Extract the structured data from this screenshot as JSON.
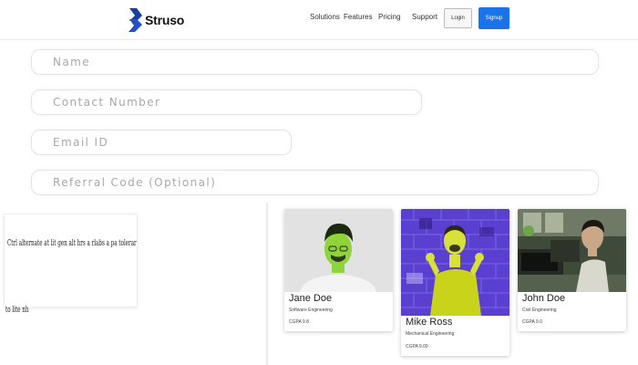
{
  "brand": {
    "name": "Struso",
    "accent": "#1a73e8",
    "logo_color": "#1a3f9e"
  },
  "nav": {
    "links": [
      "Solutions",
      "Features",
      "Pricing",
      "Support"
    ],
    "login_label": "Login",
    "signup_label": "Signup"
  },
  "form": {
    "name_placeholder": "Name",
    "contact_placeholder": "Contact Number",
    "email_placeholder": "Email ID",
    "referral_placeholder": "Referral Code (Optional)"
  },
  "promo": {
    "text_line1": "Ctrl alternate at lit gen alt hrs a rlabs a pa toleraren to sad",
    "text_line2": "to lite nh"
  },
  "profiles": [
    {
      "name": "Jane Doe",
      "role": "Software Engineering",
      "cgpa": "CGPA 9.8"
    },
    {
      "name": "Mike Ross",
      "role": "Mechanical Engineering",
      "cgpa": "CGPA 9.09"
    },
    {
      "name": "John Doe",
      "role": "Civil Engineering",
      "cgpa": "CGPA 9.0"
    }
  ]
}
